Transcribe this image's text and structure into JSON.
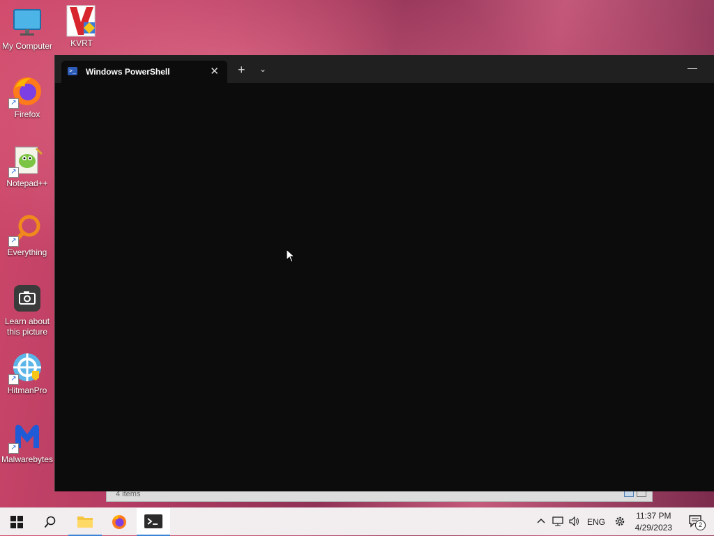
{
  "desktop": {
    "icons": [
      {
        "label": "My Computer"
      },
      {
        "label": "KVRT"
      },
      {
        "label": "Firefox"
      },
      {
        "label": "Notepad++"
      },
      {
        "label": "Everything"
      },
      {
        "label": "Learn about this picture"
      },
      {
        "label": "HitmanPro"
      },
      {
        "label": "Malwarebytes"
      }
    ]
  },
  "background_window": {
    "status_text": "4 items"
  },
  "terminal": {
    "tab_title": "Windows PowerShell",
    "tab_close_glyph": "✕",
    "new_tab_glyph": "+",
    "dropdown_glyph": "⌄",
    "minimize_glyph": "—",
    "ps_glyph": ">_"
  },
  "taskbar": {
    "tray": {
      "language": "ENG"
    },
    "clock": {
      "time": "11:37 PM",
      "date": "4/29/2023"
    },
    "notification_count": "2"
  },
  "colors": {
    "terminal_bg": "#0c0c0c",
    "titlebar_bg": "#202020",
    "taskbar_bg": "#f2eef0",
    "accent": "#3c83d6"
  }
}
